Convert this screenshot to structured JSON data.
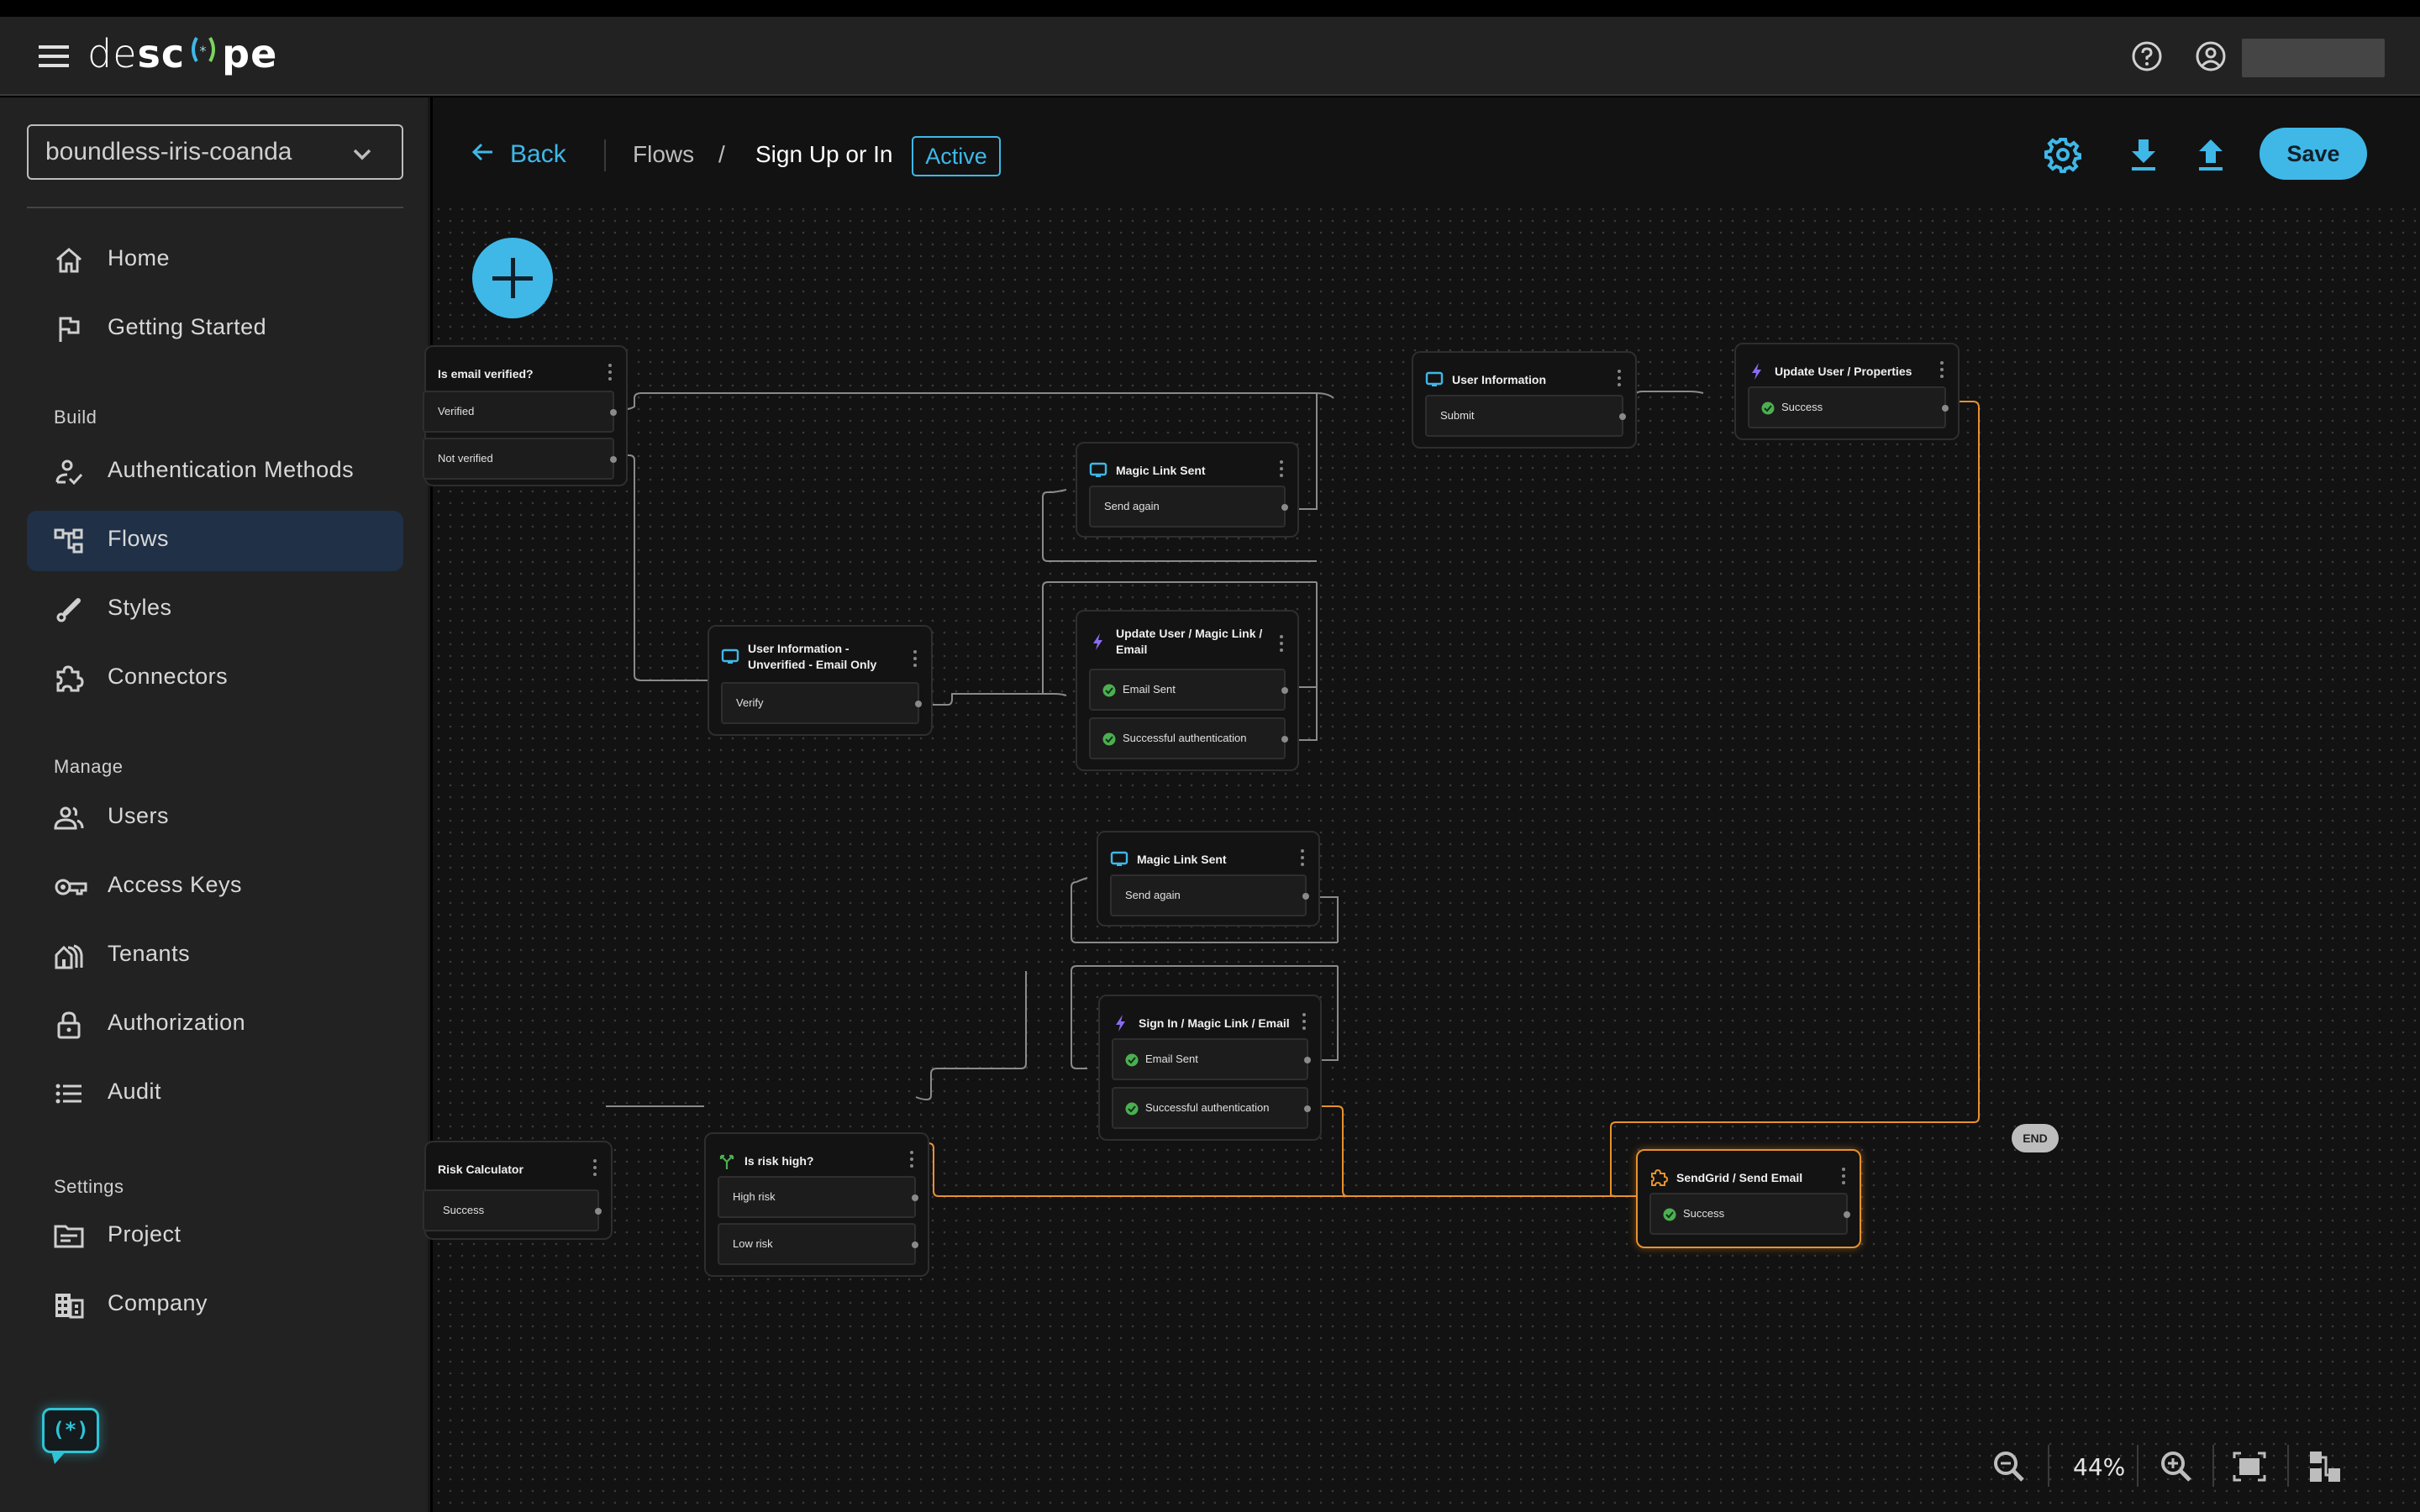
{
  "app": {
    "name": "descope",
    "logo_light": "de",
    "logo_bold_1": "sc",
    "logo_bold_2": "pe"
  },
  "header": {
    "help_icon": "help-circle-icon",
    "account_icon": "account-circle-icon"
  },
  "sidebar": {
    "project": "boundless-iris-coanda",
    "items_top": [
      {
        "label": "Home",
        "icon": "home-icon"
      },
      {
        "label": "Getting Started",
        "icon": "flag-icon"
      }
    ],
    "sections": [
      {
        "label": "Build",
        "items": [
          {
            "label": "Authentication Methods",
            "icon": "user-check-icon"
          },
          {
            "label": "Flows",
            "icon": "flows-icon",
            "active": true
          },
          {
            "label": "Styles",
            "icon": "brush-icon"
          },
          {
            "label": "Connectors",
            "icon": "puzzle-icon"
          }
        ]
      },
      {
        "label": "Manage",
        "items": [
          {
            "label": "Users",
            "icon": "users-icon"
          },
          {
            "label": "Access Keys",
            "icon": "key-icon"
          },
          {
            "label": "Tenants",
            "icon": "tenants-icon"
          },
          {
            "label": "Authorization",
            "icon": "lock-icon"
          },
          {
            "label": "Audit",
            "icon": "list-icon"
          }
        ]
      },
      {
        "label": "Settings",
        "items": [
          {
            "label": "Project",
            "icon": "folder-icon"
          },
          {
            "label": "Company",
            "icon": "building-icon"
          }
        ]
      }
    ],
    "chat_glyph": "(*)"
  },
  "toolbar": {
    "back_label": "Back",
    "breadcrumb_root": "Flows",
    "breadcrumb_sep": "/",
    "flow_name": "Sign Up or In",
    "status": "Active",
    "save_label": "Save"
  },
  "colors": {
    "accent": "#3fb8e8",
    "selected": "#e8912d",
    "success": "#4caf50",
    "action": "#8b6cf0",
    "condition": "#4caf50"
  },
  "nodes": [
    {
      "id": "is-email-verified",
      "title": "Is email verified?",
      "type": "condition",
      "outputs": [
        {
          "label": "Verified"
        },
        {
          "label": "Not verified"
        }
      ]
    },
    {
      "id": "user-information",
      "title": "User Information",
      "type": "screen",
      "outputs": [
        {
          "label": "Submit"
        }
      ]
    },
    {
      "id": "update-user-properties",
      "title": "Update User / Properties",
      "type": "action",
      "outputs": [
        {
          "label": "Success",
          "check": true
        }
      ]
    },
    {
      "id": "magic-link-sent-1",
      "title": "Magic Link Sent",
      "type": "screen",
      "outputs": [
        {
          "label": "Send again"
        }
      ]
    },
    {
      "id": "user-info-unverified",
      "title": "User Information - Unverified - Email Only",
      "type": "screen",
      "outputs": [
        {
          "label": "Verify"
        }
      ]
    },
    {
      "id": "update-user-magic-link",
      "title": "Update User / Magic Link / Email",
      "type": "action",
      "outputs": [
        {
          "label": "Email Sent",
          "check": true
        },
        {
          "label": "Successful authentication",
          "check": true
        }
      ]
    },
    {
      "id": "magic-link-sent-2",
      "title": "Magic Link Sent",
      "type": "screen",
      "outputs": [
        {
          "label": "Send again"
        }
      ]
    },
    {
      "id": "sign-in-magic-link",
      "title": "Sign In / Magic Link / Email",
      "type": "action",
      "outputs": [
        {
          "label": "Email Sent",
          "check": true
        },
        {
          "label": "Successful authentication",
          "check": true
        }
      ]
    },
    {
      "id": "risk-calculator",
      "title": "Risk Calculator",
      "type": "action",
      "outputs": [
        {
          "label": "Success",
          "check": true
        }
      ]
    },
    {
      "id": "is-risk-high",
      "title": "Is risk high?",
      "type": "condition",
      "outputs": [
        {
          "label": "High risk"
        },
        {
          "label": "Low risk"
        }
      ]
    },
    {
      "id": "sendgrid-send-email",
      "title": "SendGrid / Send Email",
      "type": "connector",
      "selected": true,
      "outputs": [
        {
          "label": "Success",
          "check": true
        }
      ]
    }
  ],
  "end_label": "END",
  "zoom": {
    "level": "44%"
  }
}
